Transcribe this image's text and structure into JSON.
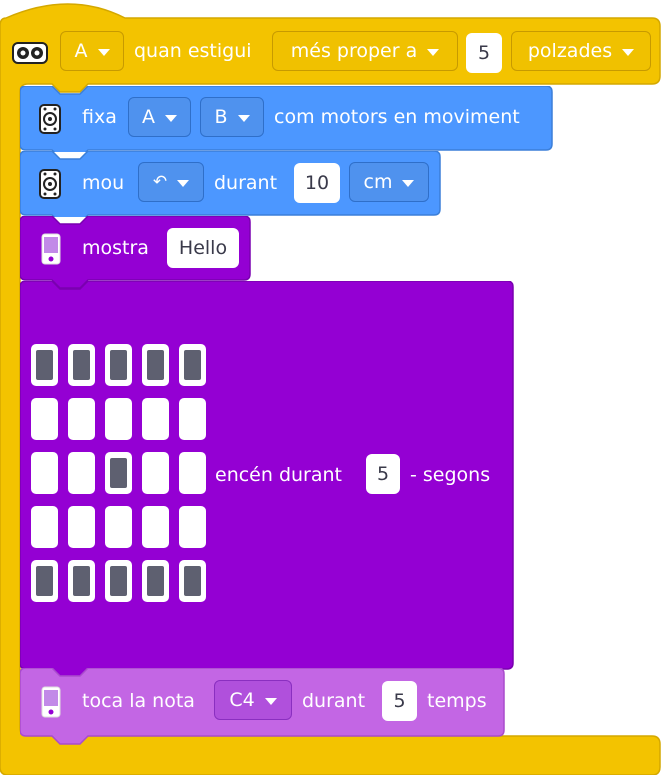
{
  "hat": {
    "sensor_port": "A",
    "when_text": "quan estigui",
    "comparison": "més proper a",
    "distance": "5",
    "unit": "polzades"
  },
  "set_motors": {
    "label": "fixa",
    "port_left": "A",
    "port_right": "B",
    "suffix": "com motors en moviment"
  },
  "move": {
    "label": "mou",
    "direction_symbol": "↶",
    "for_text": "durant",
    "amount": "10",
    "unit": "cm"
  },
  "show": {
    "label": "mostra",
    "text": "Hello"
  },
  "light": {
    "grid": [
      [
        1,
        1,
        1,
        1,
        1
      ],
      [
        0,
        0,
        0,
        0,
        0
      ],
      [
        0,
        0,
        1,
        0,
        0
      ],
      [
        0,
        0,
        0,
        0,
        0
      ],
      [
        1,
        1,
        1,
        1,
        1
      ]
    ],
    "on_text": "encén durant",
    "seconds": "5",
    "unit_text": "- segons"
  },
  "note": {
    "label": "toca la nota",
    "note": "C4",
    "for_text": "durant",
    "beats": "5",
    "unit": "temps"
  },
  "colors": {
    "events": "#f5c402",
    "motors": "#4c97ff",
    "display": "#9400d3",
    "sound": "#cf63f0"
  }
}
